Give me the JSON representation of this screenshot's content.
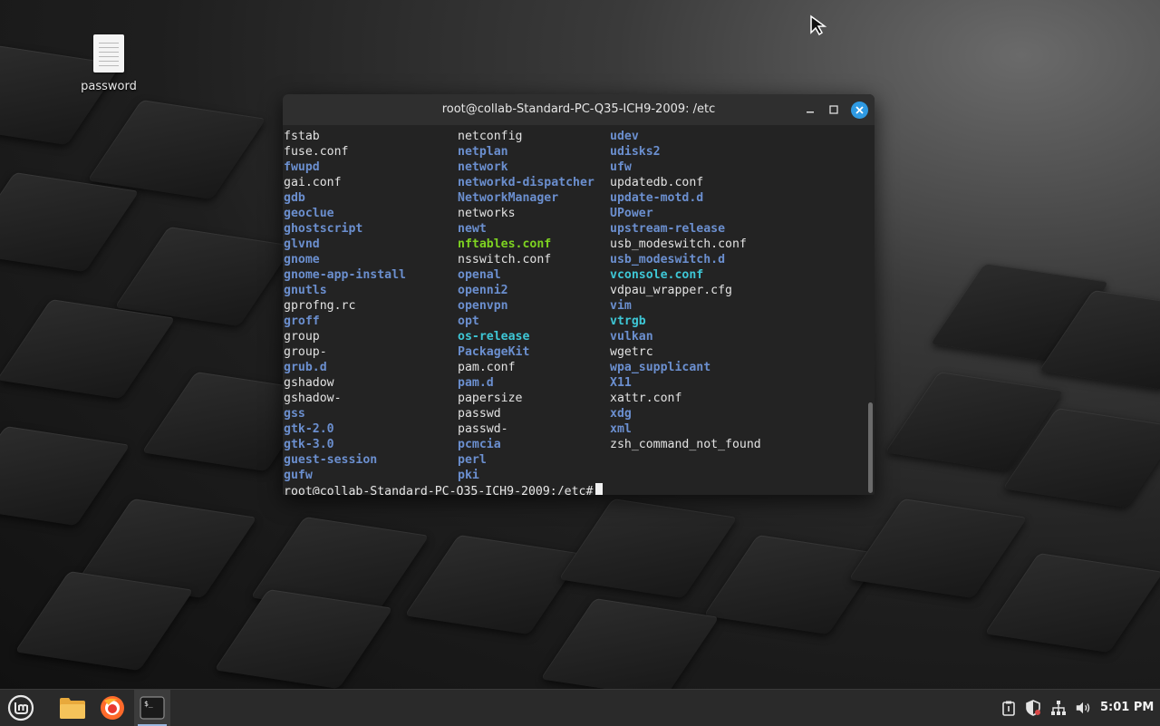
{
  "desktop": {
    "icons": [
      {
        "label": "password",
        "icon": "text-document-icon"
      }
    ]
  },
  "terminal": {
    "title": "root@collab-Standard-PC-Q35-ICH9-2009: /etc",
    "columns": [
      [
        {
          "name": "fstab",
          "type": "file"
        },
        {
          "name": "fuse.conf",
          "type": "file"
        },
        {
          "name": "fwupd",
          "type": "dir"
        },
        {
          "name": "gai.conf",
          "type": "file"
        },
        {
          "name": "gdb",
          "type": "dir"
        },
        {
          "name": "geoclue",
          "type": "dir"
        },
        {
          "name": "ghostscript",
          "type": "dir"
        },
        {
          "name": "glvnd",
          "type": "dir"
        },
        {
          "name": "gnome",
          "type": "dir"
        },
        {
          "name": "gnome-app-install",
          "type": "dir"
        },
        {
          "name": "gnutls",
          "type": "dir"
        },
        {
          "name": "gprofng.rc",
          "type": "file"
        },
        {
          "name": "groff",
          "type": "dir"
        },
        {
          "name": "group",
          "type": "file"
        },
        {
          "name": "group-",
          "type": "file"
        },
        {
          "name": "grub.d",
          "type": "dir"
        },
        {
          "name": "gshadow",
          "type": "file"
        },
        {
          "name": "gshadow-",
          "type": "file"
        },
        {
          "name": "gss",
          "type": "dir"
        },
        {
          "name": "gtk-2.0",
          "type": "dir"
        },
        {
          "name": "gtk-3.0",
          "type": "dir"
        },
        {
          "name": "guest-session",
          "type": "dir"
        },
        {
          "name": "gufw",
          "type": "dir"
        }
      ],
      [
        {
          "name": "netconfig",
          "type": "file"
        },
        {
          "name": "netplan",
          "type": "dir"
        },
        {
          "name": "network",
          "type": "dir"
        },
        {
          "name": "networkd-dispatcher",
          "type": "dir"
        },
        {
          "name": "NetworkManager",
          "type": "dir"
        },
        {
          "name": "networks",
          "type": "file"
        },
        {
          "name": "newt",
          "type": "dir"
        },
        {
          "name": "nftables.conf",
          "type": "exec"
        },
        {
          "name": "nsswitch.conf",
          "type": "file"
        },
        {
          "name": "openal",
          "type": "dir"
        },
        {
          "name": "openni2",
          "type": "dir"
        },
        {
          "name": "openvpn",
          "type": "dir"
        },
        {
          "name": "opt",
          "type": "dir"
        },
        {
          "name": "os-release",
          "type": "link"
        },
        {
          "name": "PackageKit",
          "type": "dir"
        },
        {
          "name": "pam.conf",
          "type": "file"
        },
        {
          "name": "pam.d",
          "type": "dir"
        },
        {
          "name": "papersize",
          "type": "file"
        },
        {
          "name": "passwd",
          "type": "file"
        },
        {
          "name": "passwd-",
          "type": "file"
        },
        {
          "name": "pcmcia",
          "type": "dir"
        },
        {
          "name": "perl",
          "type": "dir"
        },
        {
          "name": "pki",
          "type": "dir"
        }
      ],
      [
        {
          "name": "udev",
          "type": "dir"
        },
        {
          "name": "udisks2",
          "type": "dir"
        },
        {
          "name": "ufw",
          "type": "dir"
        },
        {
          "name": "updatedb.conf",
          "type": "file"
        },
        {
          "name": "update-motd.d",
          "type": "dir"
        },
        {
          "name": "UPower",
          "type": "dir"
        },
        {
          "name": "upstream-release",
          "type": "dir"
        },
        {
          "name": "usb_modeswitch.conf",
          "type": "file"
        },
        {
          "name": "usb_modeswitch.d",
          "type": "dir"
        },
        {
          "name": "vconsole.conf",
          "type": "link"
        },
        {
          "name": "vdpau_wrapper.cfg",
          "type": "file"
        },
        {
          "name": "vim",
          "type": "dir"
        },
        {
          "name": "vtrgb",
          "type": "link"
        },
        {
          "name": "vulkan",
          "type": "dir"
        },
        {
          "name": "wgetrc",
          "type": "file"
        },
        {
          "name": "wpa_supplicant",
          "type": "dir"
        },
        {
          "name": "X11",
          "type": "dir"
        },
        {
          "name": "xattr.conf",
          "type": "file"
        },
        {
          "name": "xdg",
          "type": "dir"
        },
        {
          "name": "xml",
          "type": "dir"
        },
        {
          "name": "zsh_command_not_found",
          "type": "file"
        }
      ]
    ],
    "prompt": "root@collab-Standard-PC-Q35-ICH9-2009:/etc#",
    "colors": {
      "file": "#e2e2e2",
      "dir": "#6b8fcf",
      "link": "#3ec7d6",
      "exec": "#7ed321",
      "close": "#2f9ae3"
    }
  },
  "taskbar": {
    "apps": [
      {
        "name": "menu",
        "icon": "linux-mint-logo-icon"
      },
      {
        "name": "files",
        "icon": "folder-icon"
      },
      {
        "name": "firefox",
        "icon": "firefox-icon"
      },
      {
        "name": "terminal",
        "icon": "terminal-icon",
        "active": true
      }
    ],
    "tray": [
      "clipboard-icon",
      "shield-icon",
      "network-icon",
      "volume-icon"
    ],
    "clock": "5:01 PM"
  }
}
